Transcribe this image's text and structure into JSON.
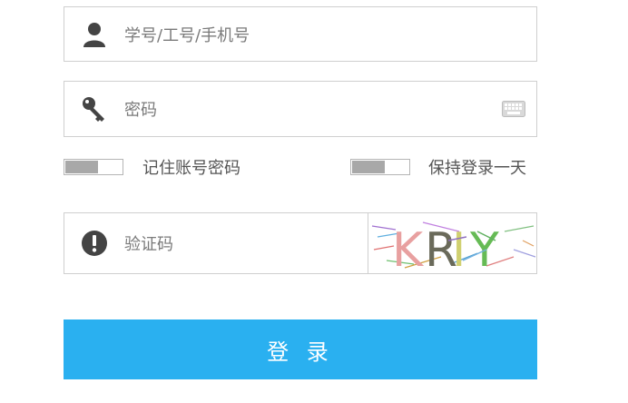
{
  "username": {
    "placeholder": "学号/工号/手机号"
  },
  "password": {
    "placeholder": "密码"
  },
  "remember": {
    "label": "记住账号密码"
  },
  "keep_login": {
    "label": "保持登录一天"
  },
  "captcha": {
    "placeholder": "验证码",
    "image_text": "KRIY"
  },
  "login_button": {
    "label": "登 录"
  },
  "colors": {
    "primary": "#2ab0f0",
    "border": "#cfcfcf",
    "icon": "#444444",
    "toggle_knob": "#a8a8a8"
  }
}
